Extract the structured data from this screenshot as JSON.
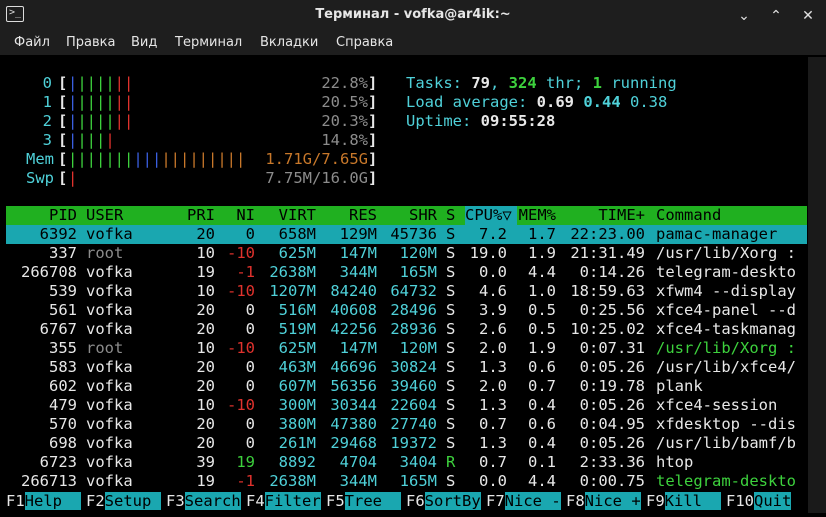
{
  "window": {
    "title": "Терминал - vofka@ar4ik:~",
    "app_icon": ">_",
    "min_icon": "⌄",
    "max_icon": "⌃",
    "close_icon": "✕"
  },
  "menu": [
    "Файл",
    "Правка",
    "Вид",
    "Терминал",
    "Вкладки",
    "Справка"
  ],
  "meters": {
    "cpus": [
      {
        "label": "0",
        "percent": 22.8,
        "text": "22.8%"
      },
      {
        "label": "1",
        "percent": 20.5,
        "text": "20.5%"
      },
      {
        "label": "2",
        "percent": 20.3,
        "text": "20.3%"
      },
      {
        "label": "3",
        "percent": 14.8,
        "text": "14.8%"
      }
    ],
    "mem": {
      "label": "Mem",
      "text": "1.71G/7.65G"
    },
    "swp": {
      "label": "Swp",
      "text": "7.75M/16.0G"
    },
    "tasks_label": "Tasks: ",
    "tasks": "79",
    "thr": "324",
    "thr_label": " thr; ",
    "running": "1",
    "running_label": " running",
    "load_label": "Load average: ",
    "load1": "0.69",
    "load5": "0.44",
    "load15": "0.38",
    "uptime_label": "Uptime: ",
    "uptime": "09:55:28"
  },
  "columns": {
    "pid": "PID",
    "user": "USER",
    "pri": "PRI",
    "ni": "NI",
    "virt": "VIRT",
    "res": "RES",
    "shr": "SHR",
    "s": "S",
    "cpu": "CPU%▽",
    "mem": "MEM%",
    "time": "TIME+",
    "command": "Command"
  },
  "processes": [
    {
      "pid": "6392",
      "user": "vofka",
      "pri": "20",
      "ni": "0",
      "virt": "658M",
      "res": "129M",
      "shr": "45736",
      "s": "S",
      "cpu": "7.2",
      "mem": "1.7",
      "time": "22:23.00",
      "command": "pamac-manager"
    },
    {
      "pid": "337",
      "user": "root",
      "pri": "10",
      "ni": "-10",
      "virt": "625M",
      "res": "147M",
      "shr": "120M",
      "s": "S",
      "cpu": "19.0",
      "mem": "1.9",
      "time": "21:31.49",
      "command": "/usr/lib/Xorg :"
    },
    {
      "pid": "266708",
      "user": "vofka",
      "pri": "19",
      "ni": "-1",
      "virt": "2638M",
      "res": "344M",
      "shr": "165M",
      "s": "S",
      "cpu": "0.0",
      "mem": "4.4",
      "time": "0:14.26",
      "command": "telegram-deskto"
    },
    {
      "pid": "539",
      "user": "vofka",
      "pri": "10",
      "ni": "-10",
      "virt": "1207M",
      "res": "84240",
      "shr": "64732",
      "s": "S",
      "cpu": "4.6",
      "mem": "1.0",
      "time": "18:59.63",
      "command": "xfwm4 --display"
    },
    {
      "pid": "561",
      "user": "vofka",
      "pri": "20",
      "ni": "0",
      "virt": "516M",
      "res": "40608",
      "shr": "28496",
      "s": "S",
      "cpu": "3.9",
      "mem": "0.5",
      "time": "0:25.56",
      "command": "xfce4-panel --d"
    },
    {
      "pid": "6767",
      "user": "vofka",
      "pri": "20",
      "ni": "0",
      "virt": "519M",
      "res": "42256",
      "shr": "28936",
      "s": "S",
      "cpu": "2.6",
      "mem": "0.5",
      "time": "10:25.02",
      "command": "xfce4-taskmanag"
    },
    {
      "pid": "355",
      "user": "root",
      "pri": "10",
      "ni": "-10",
      "virt": "625M",
      "res": "147M",
      "shr": "120M",
      "s": "S",
      "cpu": "2.0",
      "mem": "1.9",
      "time": "0:07.31",
      "command": "/usr/lib/Xorg :"
    },
    {
      "pid": "583",
      "user": "vofka",
      "pri": "20",
      "ni": "0",
      "virt": "463M",
      "res": "46696",
      "shr": "30824",
      "s": "S",
      "cpu": "1.3",
      "mem": "0.6",
      "time": "0:05.26",
      "command": "/usr/lib/xfce4/"
    },
    {
      "pid": "602",
      "user": "vofka",
      "pri": "20",
      "ni": "0",
      "virt": "607M",
      "res": "56356",
      "shr": "39460",
      "s": "S",
      "cpu": "2.0",
      "mem": "0.7",
      "time": "0:19.78",
      "command": "plank"
    },
    {
      "pid": "479",
      "user": "vofka",
      "pri": "10",
      "ni": "-10",
      "virt": "300M",
      "res": "30344",
      "shr": "22604",
      "s": "S",
      "cpu": "1.3",
      "mem": "0.4",
      "time": "0:05.26",
      "command": "xfce4-session"
    },
    {
      "pid": "570",
      "user": "vofka",
      "pri": "20",
      "ni": "0",
      "virt": "380M",
      "res": "47380",
      "shr": "27740",
      "s": "S",
      "cpu": "0.7",
      "mem": "0.6",
      "time": "0:04.95",
      "command": "xfdesktop --dis"
    },
    {
      "pid": "698",
      "user": "vofka",
      "pri": "20",
      "ni": "0",
      "virt": "261M",
      "res": "29468",
      "shr": "19372",
      "s": "S",
      "cpu": "1.3",
      "mem": "0.4",
      "time": "0:05.26",
      "command": "/usr/lib/bamf/b"
    },
    {
      "pid": "6723",
      "user": "vofka",
      "pri": "39",
      "ni": "19",
      "virt": "8892",
      "res": "4704",
      "shr": "3404",
      "s": "R",
      "cpu": "0.7",
      "mem": "0.1",
      "time": "2:33.36",
      "command": "htop"
    },
    {
      "pid": "266713",
      "user": "vofka",
      "pri": "19",
      "ni": "-1",
      "virt": "2638M",
      "res": "344M",
      "shr": "165M",
      "s": "S",
      "cpu": "0.0",
      "mem": "4.4",
      "time": "0:00.75",
      "command": "telegram-deskto"
    }
  ],
  "fkeys": [
    {
      "key": "F1",
      "label": "Help  "
    },
    {
      "key": "F2",
      "label": "Setup "
    },
    {
      "key": "F3",
      "label": "Search"
    },
    {
      "key": "F4",
      "label": "Filter"
    },
    {
      "key": "F5",
      "label": "Tree  "
    },
    {
      "key": "F6",
      "label": "SortBy"
    },
    {
      "key": "F7",
      "label": "Nice -"
    },
    {
      "key": "F8",
      "label": "Nice +"
    },
    {
      "key": "F9",
      "label": "Kill  "
    },
    {
      "key": "F10",
      "label": "Quit"
    }
  ],
  "colors": {
    "cyan": "#4fd1d9",
    "green": "#3dd13d",
    "red": "#e0322d",
    "header_bg": "#20b020",
    "selected_bg": "#1aa7b0"
  }
}
